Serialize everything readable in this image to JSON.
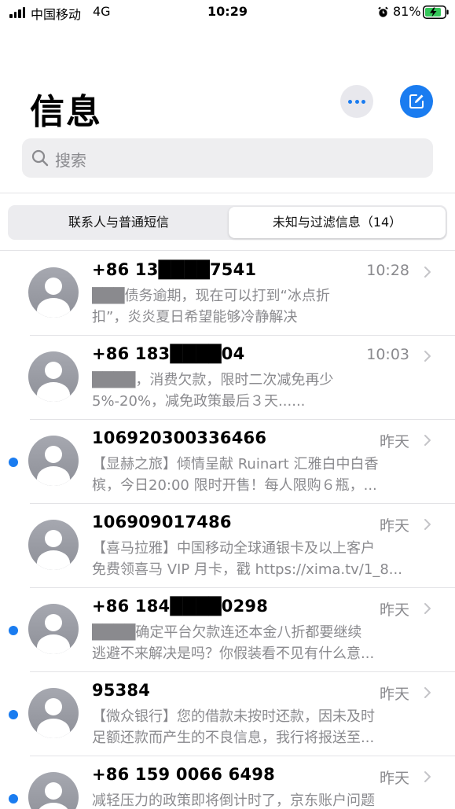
{
  "status_bar": {
    "carrier": "中国移动",
    "network": "4G",
    "time": "10:29",
    "battery": "81%"
  },
  "header": {
    "title": "信息",
    "more_icon": "ellipsis-icon",
    "compose_icon": "compose-icon"
  },
  "search": {
    "placeholder": "搜索"
  },
  "tabs": {
    "left": "联系人与普通短信",
    "right": "未知与过滤信息（14）",
    "selected": "right"
  },
  "messages": [
    {
      "sender": "+86 13████7541",
      "time": "10:28",
      "line1": "███债务逾期，现在可以打到“冰点折",
      "line2": "扣”，炎炎夏日希望能够冷静解决",
      "unread": false
    },
    {
      "sender": "+86 183████04",
      "time": "10:03",
      "line1": "████，消费欠款，限时二次减免再少",
      "line2": "5%-20%，减免政策最后３天......",
      "unread": false
    },
    {
      "sender": "106920300336466",
      "time": "昨天",
      "line1": "【显赫之旅】倾情呈献 Ruinart 汇雅白中白香",
      "line2": "槟，今日20:00 限时开售！每人限购６瓶，...",
      "unread": true
    },
    {
      "sender": "106909017486",
      "time": "昨天",
      "line1": "【喜马拉雅】中国移动全球通银卡及以上客户",
      "line2": "免费领喜马 VIP 月卡，戳 https://xima.tv/1_8...",
      "unread": false
    },
    {
      "sender": "+86 184████0298",
      "time": "昨天",
      "line1": "████确定平台欠款连还本金八折都要继续",
      "line2": "逃避不来解决是吗？你假装看不见有什么意...",
      "unread": true
    },
    {
      "sender": "95384",
      "time": "昨天",
      "line1": "【微众银行】您的借款未按时还款，因未及时",
      "line2": "足额还款而产生的不良信息，我行将报送至...",
      "unread": true
    },
    {
      "sender": "+86 159 0066 6498",
      "time": "昨天",
      "line1": "减轻压力的政策即将倒计时了，京东账户问题",
      "line2": "",
      "unread": true
    }
  ],
  "colors": {
    "accent": "#1a7cf0",
    "secondary_text": "#8a8a8e",
    "avatar": "#9a9ca4"
  }
}
